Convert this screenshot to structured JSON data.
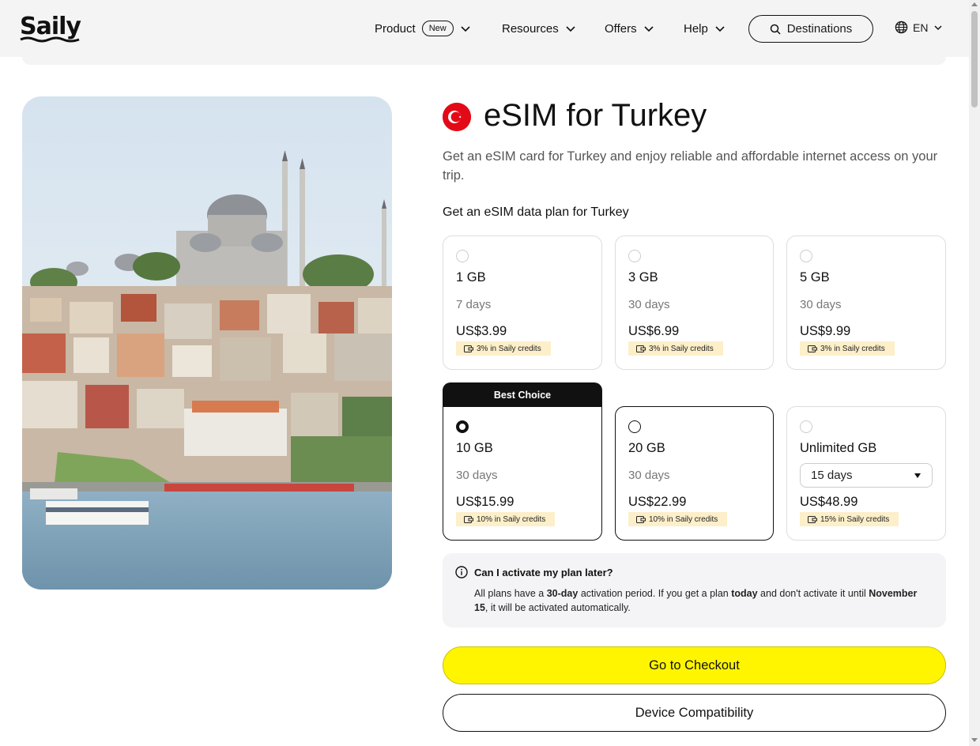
{
  "brand": {
    "logo": "Saily",
    "accent": "#fff500",
    "flag_red": "#e30a17"
  },
  "nav": {
    "product": "Product",
    "new_badge": "New",
    "resources": "Resources",
    "offers": "Offers",
    "help": "Help",
    "destinations": "Destinations",
    "language": "EN"
  },
  "page": {
    "title": "eSIM for Turkey",
    "subtitle": "Get an eSIM card for Turkey and enjoy reliable and affordable internet access on your trip.",
    "plan_heading": "Get an eSIM data plan for Turkey",
    "best_label": "Best Choice"
  },
  "plans": [
    {
      "gb": "1 GB",
      "days": "7 days",
      "price": "US$3.99",
      "credits": "3% in Saily credits",
      "state": "disabled"
    },
    {
      "gb": "3 GB",
      "days": "30 days",
      "price": "US$6.99",
      "credits": "3% in Saily credits",
      "state": "disabled"
    },
    {
      "gb": "5 GB",
      "days": "30 days",
      "price": "US$9.99",
      "credits": "3% in Saily credits",
      "state": "disabled"
    },
    {
      "gb": "10 GB",
      "days": "30 days",
      "price": "US$15.99",
      "credits": "10% in Saily credits",
      "state": "selected"
    },
    {
      "gb": "20 GB",
      "days": "30 days",
      "price": "US$22.99",
      "credits": "10% in Saily credits",
      "state": "enabled"
    },
    {
      "gb": "Unlimited GB",
      "days": "15 days",
      "price": "US$48.99",
      "credits": "15% in Saily credits",
      "state": "disabled"
    }
  ],
  "info": {
    "question": "Can I activate my plan later?",
    "a1": "All plans have a ",
    "a_bold1": "30-day",
    "a2": " activation period. If you get a plan ",
    "a_bold2": "today",
    "a3": " and don't activate it until ",
    "a_bold3": "November 15",
    "a4": ", it will be activated automatically."
  },
  "buttons": {
    "checkout": "Go to Checkout",
    "compat": "Device Compatibility"
  }
}
